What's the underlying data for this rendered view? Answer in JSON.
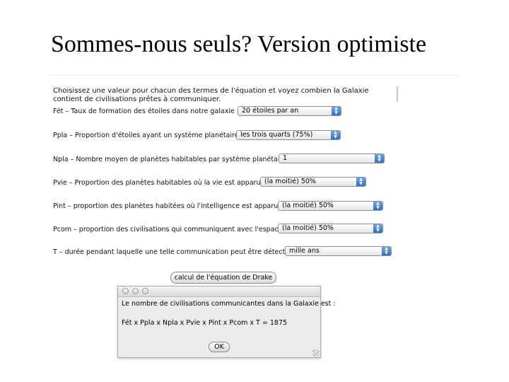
{
  "slide": {
    "title": "Sommes-nous seuls? Version optimiste"
  },
  "intro": "Choisissez une valeur pour chacun des termes de l'équation et voyez combien la Galaxie contient de civilisations prêtes à communiquer.",
  "fields": [
    {
      "label": "Fét – Taux de formation des étoiles dans notre galaxie :",
      "value": "20 étoiles par an"
    },
    {
      "label": "Ppla – Proportion d'étoiles ayant un système planétaire :",
      "value": "les trois quarts (75%)"
    },
    {
      "label": "Npla – Nombre moyen de planètes habitables par système planétaire :",
      "value": "1"
    },
    {
      "label": "Pvie – Proportion des planètes habitables où la vie est apparue :",
      "value": "(la moitié) 50%"
    },
    {
      "label": "Pint – proportion des planètes habitées où l'intelligence est apparue :",
      "value": "(la moitié) 50%"
    },
    {
      "label": "Pcom – proportion des civilisations qui communiquent avec l'espace :",
      "value": "(la moitié) 50%"
    },
    {
      "label": "T – durée pendant laquelle une telle communication peut être détectée :",
      "value": "mille ans"
    }
  ],
  "calculate_button": "calcul de l'équation de Drake",
  "dialog": {
    "message": "Le nombre de civilisations communicantes dans la Galaxie est :",
    "formula": "Fét x Ppla x Npla x Pvie x Pint x Pcom x T = 1875",
    "ok": "OK"
  }
}
